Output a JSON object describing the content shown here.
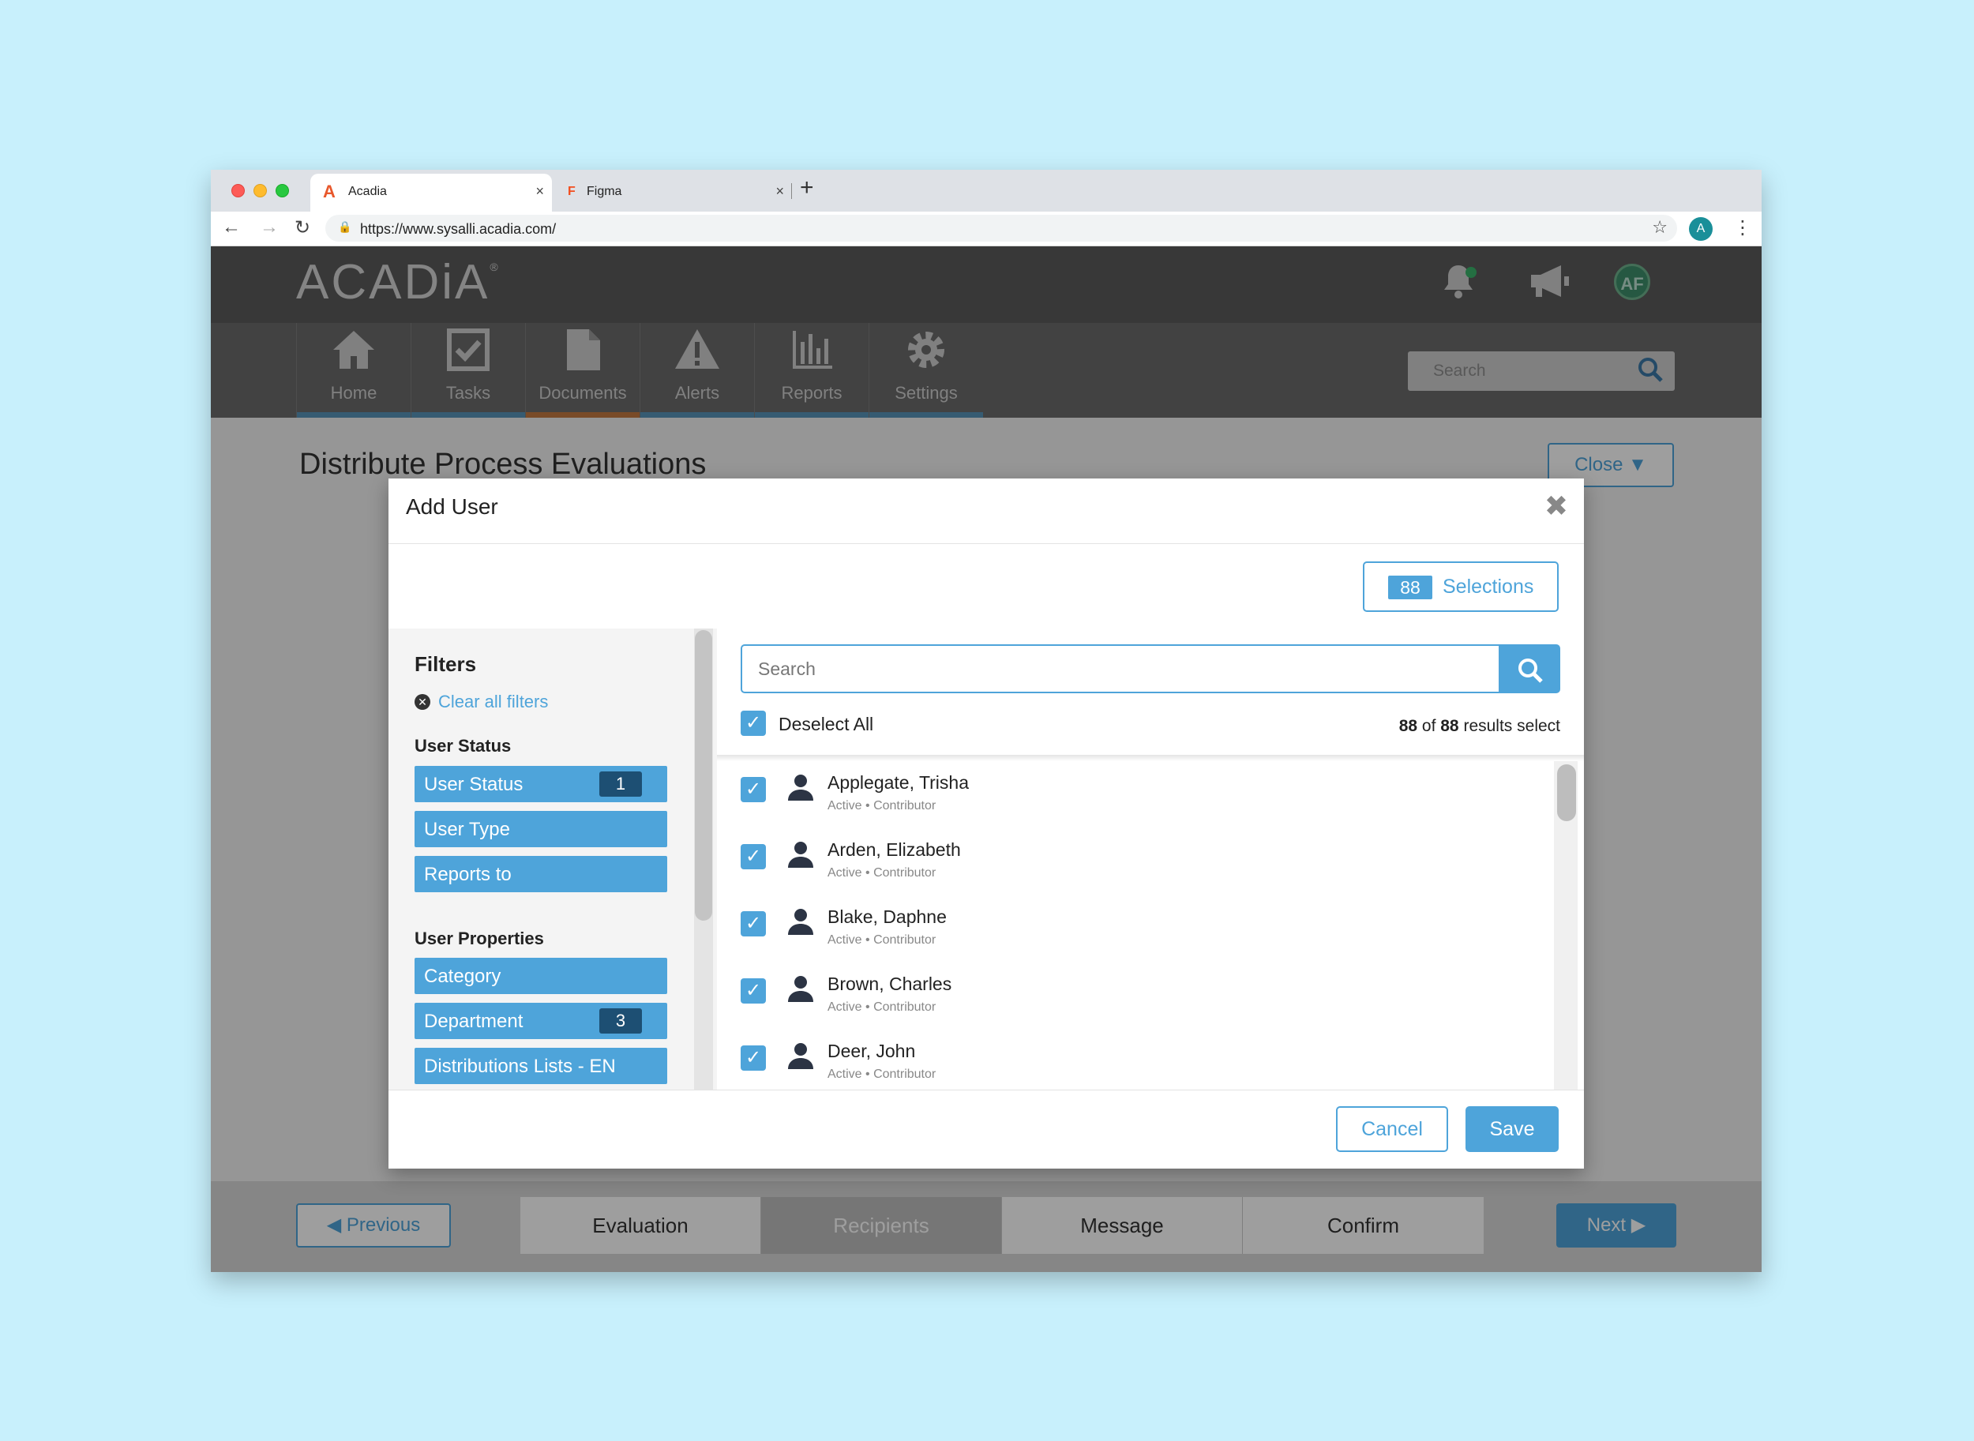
{
  "browser": {
    "tabs": [
      {
        "title": "Acadia",
        "favicon": "A",
        "favicon_color": "#e8582c"
      },
      {
        "title": "Figma",
        "favicon": "F",
        "favicon_color": "#f24e1e"
      }
    ],
    "url": "https://www.sysalli.acadia.com/",
    "profile_initial": "A",
    "close_glyph": "×",
    "new_tab_glyph": "+"
  },
  "app": {
    "logo": "ACADiA",
    "logo_mark": "®",
    "avatar_initials": "AF",
    "nav": [
      {
        "label": "Home",
        "icon": "home-icon"
      },
      {
        "label": "Tasks",
        "icon": "tasks-icon"
      },
      {
        "label": "Documents",
        "icon": "documents-icon"
      },
      {
        "label": "Alerts",
        "icon": "alerts-icon"
      },
      {
        "label": "Reports",
        "icon": "reports-icon"
      },
      {
        "label": "Settings",
        "icon": "settings-icon"
      }
    ],
    "search_placeholder": "Search"
  },
  "page": {
    "title": "Distribute Process Evaluations",
    "close_label": "Close",
    "previous_label": "Previous",
    "next_label": "Next",
    "steps": [
      "Evaluation",
      "Recipients",
      "Message",
      "Confirm"
    ]
  },
  "modal": {
    "title": "Add User",
    "selections_count": "88",
    "selections_label": "Selections",
    "filters": {
      "heading": "Filters",
      "clear_label": "Clear all filters",
      "user_status_heading": "User Status",
      "user_status": [
        {
          "label": "User Status",
          "badge": "1"
        },
        {
          "label": "User Type",
          "badge": ""
        },
        {
          "label": "Reports to",
          "badge": ""
        }
      ],
      "user_properties_heading": "User Properties",
      "user_properties": [
        {
          "label": "Category",
          "badge": ""
        },
        {
          "label": "Department",
          "badge": "3"
        },
        {
          "label": "Distributions Lists - EN",
          "badge": ""
        }
      ]
    },
    "search_placeholder": "Search",
    "deselect_label": "Deselect All",
    "results": {
      "selected": "88",
      "of_word": "of",
      "total": "88",
      "suffix": "results select"
    },
    "users": [
      {
        "name": "Applegate, Trisha",
        "sub": "Active • Contributor"
      },
      {
        "name": "Arden, Elizabeth",
        "sub": "Active • Contributor"
      },
      {
        "name": "Blake, Daphne",
        "sub": "Active • Contributor"
      },
      {
        "name": "Brown, Charles",
        "sub": "Active • Contributor"
      },
      {
        "name": "Deer, John",
        "sub": "Active • Contributor"
      }
    ],
    "cancel_label": "Cancel",
    "save_label": "Save"
  },
  "colors": {
    "accent": "#4ea4da",
    "badge_dark": "#1d4f73",
    "active_tab_bar": "#c47a42"
  }
}
